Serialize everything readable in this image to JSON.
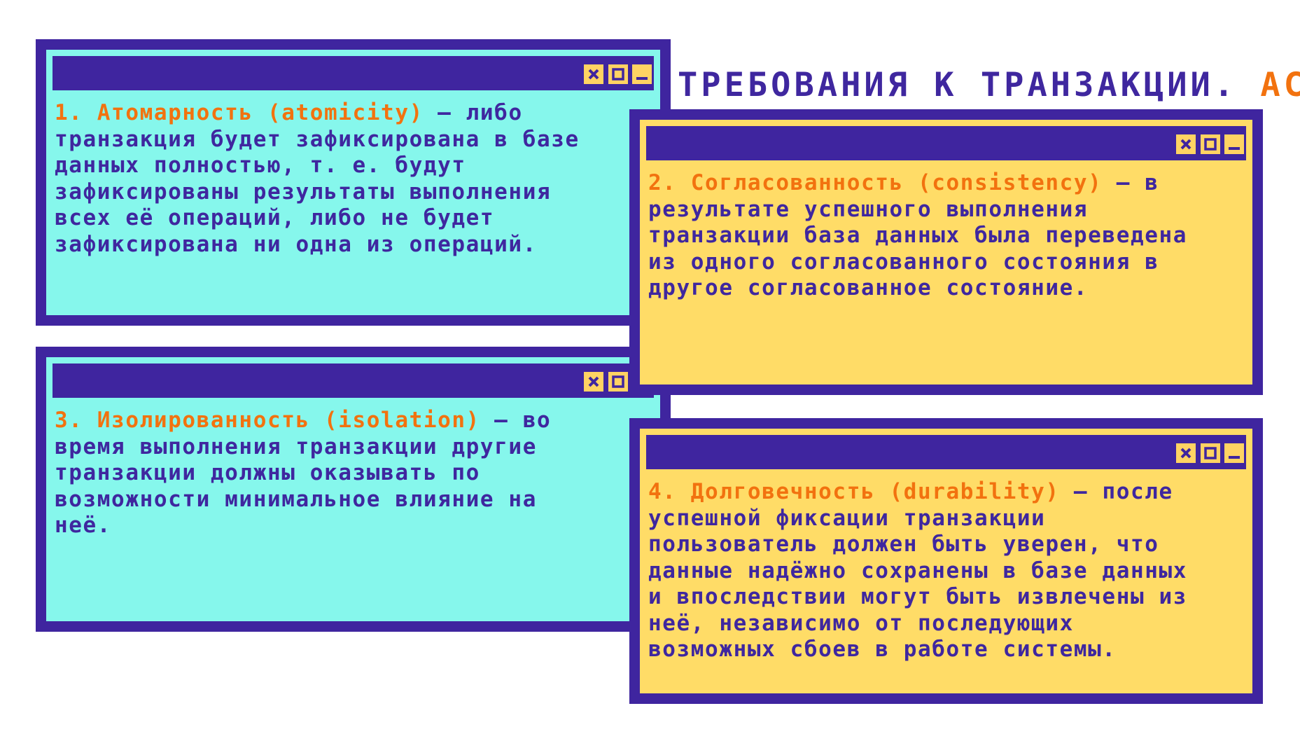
{
  "title": {
    "main": "ТРЕБОВАНИЯ К ТРАНЗАКЦИИ.",
    "accent": "ACID"
  },
  "colors": {
    "frame": "#3f259f",
    "cyan_window": "#86f7ec",
    "yellow_window": "#ffdc67",
    "accent": "#f2720f",
    "text": "#3f279f",
    "buttons": "#ffd363"
  },
  "window_icons": [
    "close-icon",
    "maximize-icon",
    "minimize-icon"
  ],
  "windows": [
    {
      "term": "1. Атомарность (atomicity)",
      "body": " – либо\nтранзакция будет зафиксирована в базе\nданных полностью, т. е. будут\nзафиксированы результаты выполнения\nвсех её операций, либо не будет\nзафиксирована ни одна из операций."
    },
    {
      "term": "2. Согласованность (consistency)",
      "body": " – в\nрезультате успешного выполнения\nтранзакции база данных была переведена\nиз одного согласованного состояния в\nдругое согласованное состояние."
    },
    {
      "term": "3. Изолированность (isolation)",
      "body": " – во\nвремя выполнения транзакции другие\nтранзакции должны оказывать по\nвозможности минимальное влияние на\nнеё."
    },
    {
      "term": "4. Долговечность (durability)",
      "body": " – после\nуспешной фиксации транзакции\nпользователь должен быть уверен, что\nданные надёжно сохранены в базе данных\nи впоследствии могут быть извлечены из\nнеё, независимо от последующих\nвозможных сбоев в работе системы."
    }
  ]
}
